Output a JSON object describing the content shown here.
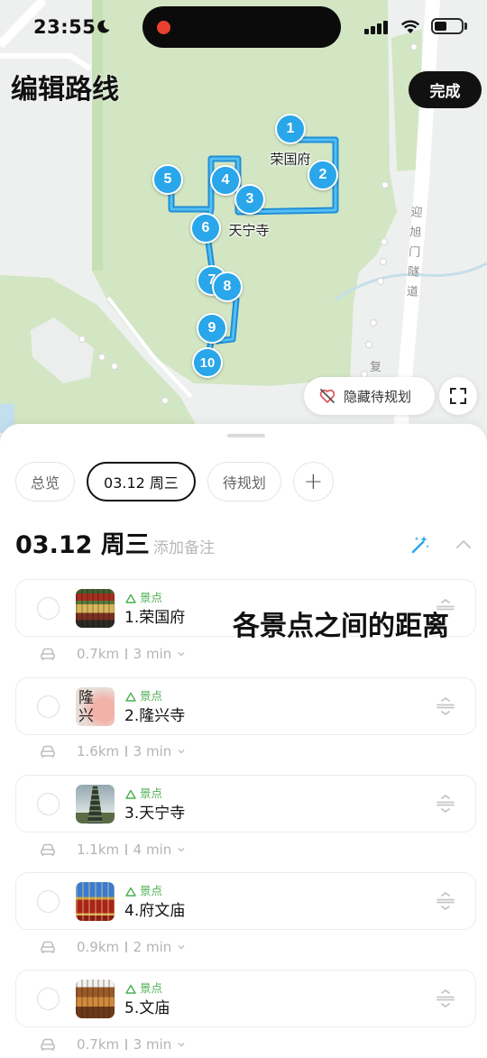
{
  "status_bar": {
    "time": "23:55",
    "battery_level": 0.45
  },
  "header": {
    "title": "编辑路线",
    "done_label": "完成"
  },
  "map": {
    "markers": [
      "1",
      "2",
      "3",
      "4",
      "5",
      "6",
      "7",
      "8",
      "9",
      "10"
    ],
    "place_labels": [
      "荣国府",
      "天宁寺"
    ],
    "road_label": "迎旭门隧道",
    "road_label_fragment": "复",
    "hide_pending_label": "隐藏待规划"
  },
  "tabs": [
    {
      "label": "总览",
      "selected": false
    },
    {
      "label": "03.12 周三",
      "selected": true
    },
    {
      "label": "待规划",
      "selected": false
    },
    {
      "label": "+",
      "selected": false
    }
  ],
  "day": {
    "title": "03.12 周三",
    "note_placeholder": "添加备注"
  },
  "stops": [
    {
      "tag": "景点",
      "name": "1.荣国府",
      "leg_distance": "0.7km",
      "leg_duration": "3 min"
    },
    {
      "tag": "景点",
      "name": "2.隆兴寺",
      "leg_distance": "1.6km",
      "leg_duration": "3 min",
      "thumbnail_lettering": [
        "隆",
        "兴"
      ]
    },
    {
      "tag": "景点",
      "name": "3.天宁寺",
      "leg_distance": "1.1km",
      "leg_duration": "4 min"
    },
    {
      "tag": "景点",
      "name": "4.府文庙",
      "leg_distance": "0.9km",
      "leg_duration": "2 min"
    },
    {
      "tag": "景点",
      "name": "5.文庙",
      "leg_distance": "0.7km",
      "leg_duration": "3 min"
    }
  ],
  "overlay_caption": "各景点之间的距离",
  "icons": {
    "status": [
      "moon-icon",
      "cellular-signal-icon",
      "wifi-icon",
      "battery-icon"
    ],
    "map": [
      "heart-off-icon",
      "fullscreen-icon"
    ],
    "day_header": [
      "magic-wand-icon",
      "chevron-up-icon"
    ],
    "stop": [
      "scenic-spot-icon",
      "reorder-handle-icon"
    ],
    "leg": [
      "car-icon",
      "chevron-down-icon"
    ]
  },
  "colors": {
    "marker": "#2aa6ea",
    "route": "#1f8fd6",
    "park": "#d2e6c3",
    "tag_green": "#4caf50",
    "done_button": "#111111",
    "recording_dot": "#e8412f"
  }
}
